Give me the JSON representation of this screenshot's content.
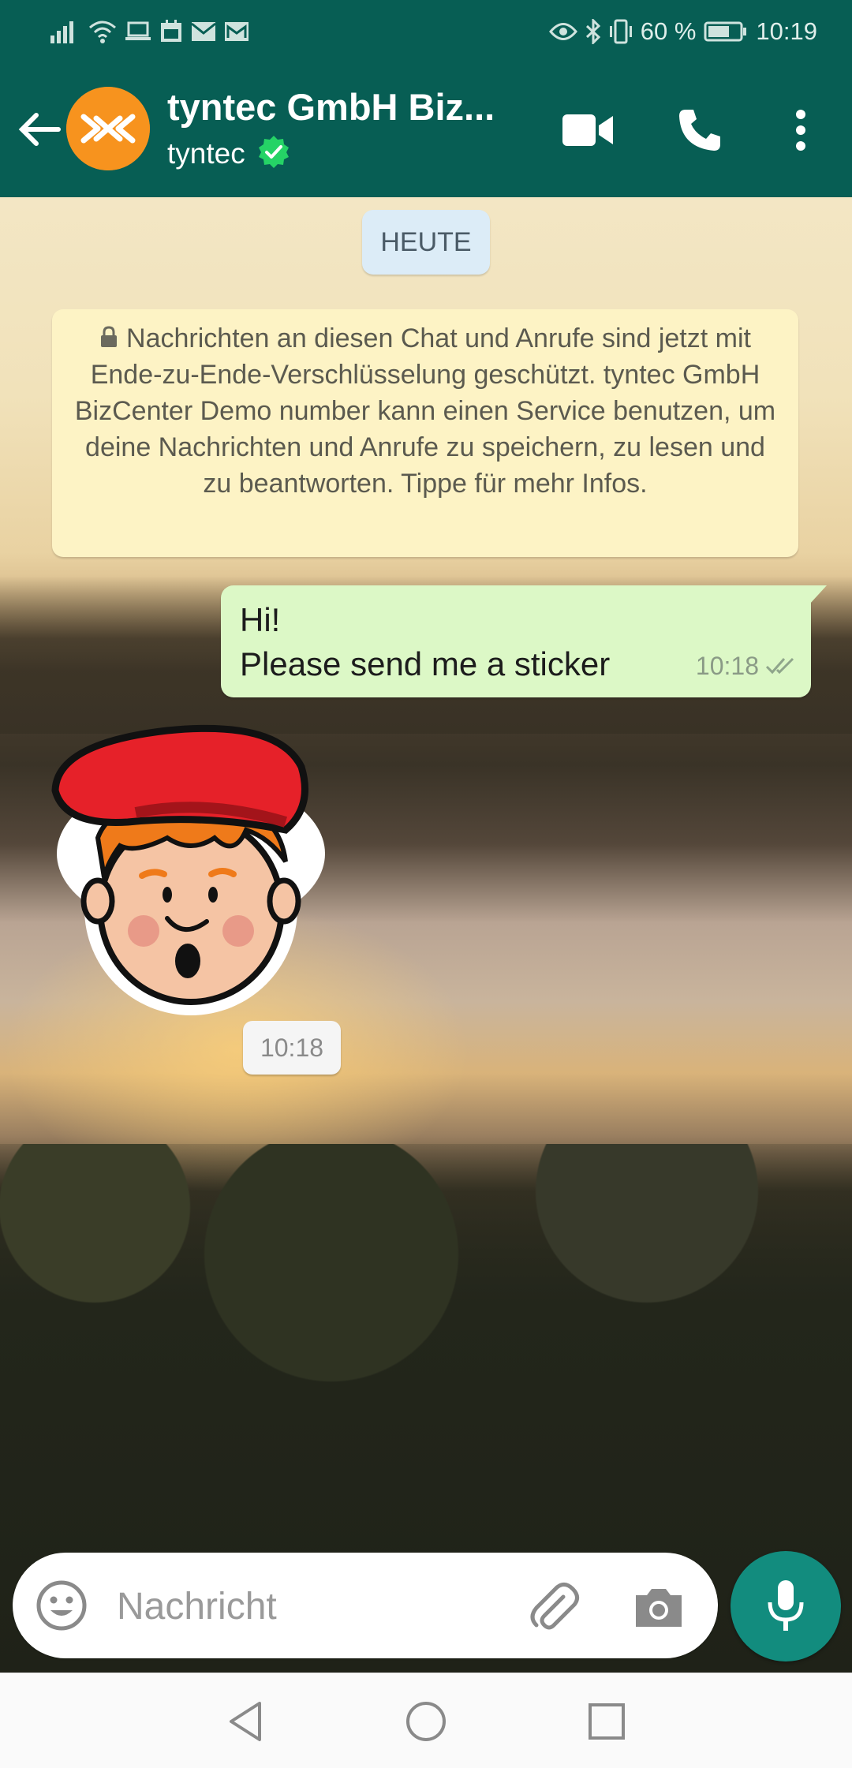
{
  "status_bar": {
    "battery_percent": "60 %",
    "time": "10:19",
    "icons": [
      "signal-icon",
      "wifi-icon",
      "laptop-icon",
      "calendar-icon",
      "mail-icon",
      "mail-icon",
      "eye-icon",
      "bluetooth-icon",
      "vibrate-icon",
      "battery-icon"
    ]
  },
  "header": {
    "title": "tyntec GmbH Biz...",
    "subtitle": "tyntec",
    "verified": true,
    "actions": [
      "video-call-icon",
      "voice-call-icon",
      "more-options-icon"
    ]
  },
  "chat": {
    "date_chip": "HEUTE",
    "encryption_notice": "Nachrichten an diesen Chat und Anrufe sind jetzt mit Ende-zu-Ende-Verschlüsselung geschützt. tyntec GmbH BizCenter Demo number kann einen Service benutzen, um deine Nachrichten und Anrufe zu speichern, zu lesen und zu beantworten. Tippe für mehr Infos.",
    "messages": [
      {
        "direction": "outgoing",
        "line1": "Hi!",
        "line2": "Please send me a sticker",
        "time": "10:18",
        "status": "read"
      },
      {
        "direction": "incoming",
        "type": "sticker",
        "time": "10:18"
      }
    ]
  },
  "composer": {
    "placeholder": "Nachricht",
    "value": ""
  },
  "colors": {
    "header": "#075e54",
    "outgoing_bubble": "#dcf8c6",
    "notice_bubble": "#fdf3c5",
    "mic_button": "#128c7e",
    "verified_badge": "#25d366"
  }
}
